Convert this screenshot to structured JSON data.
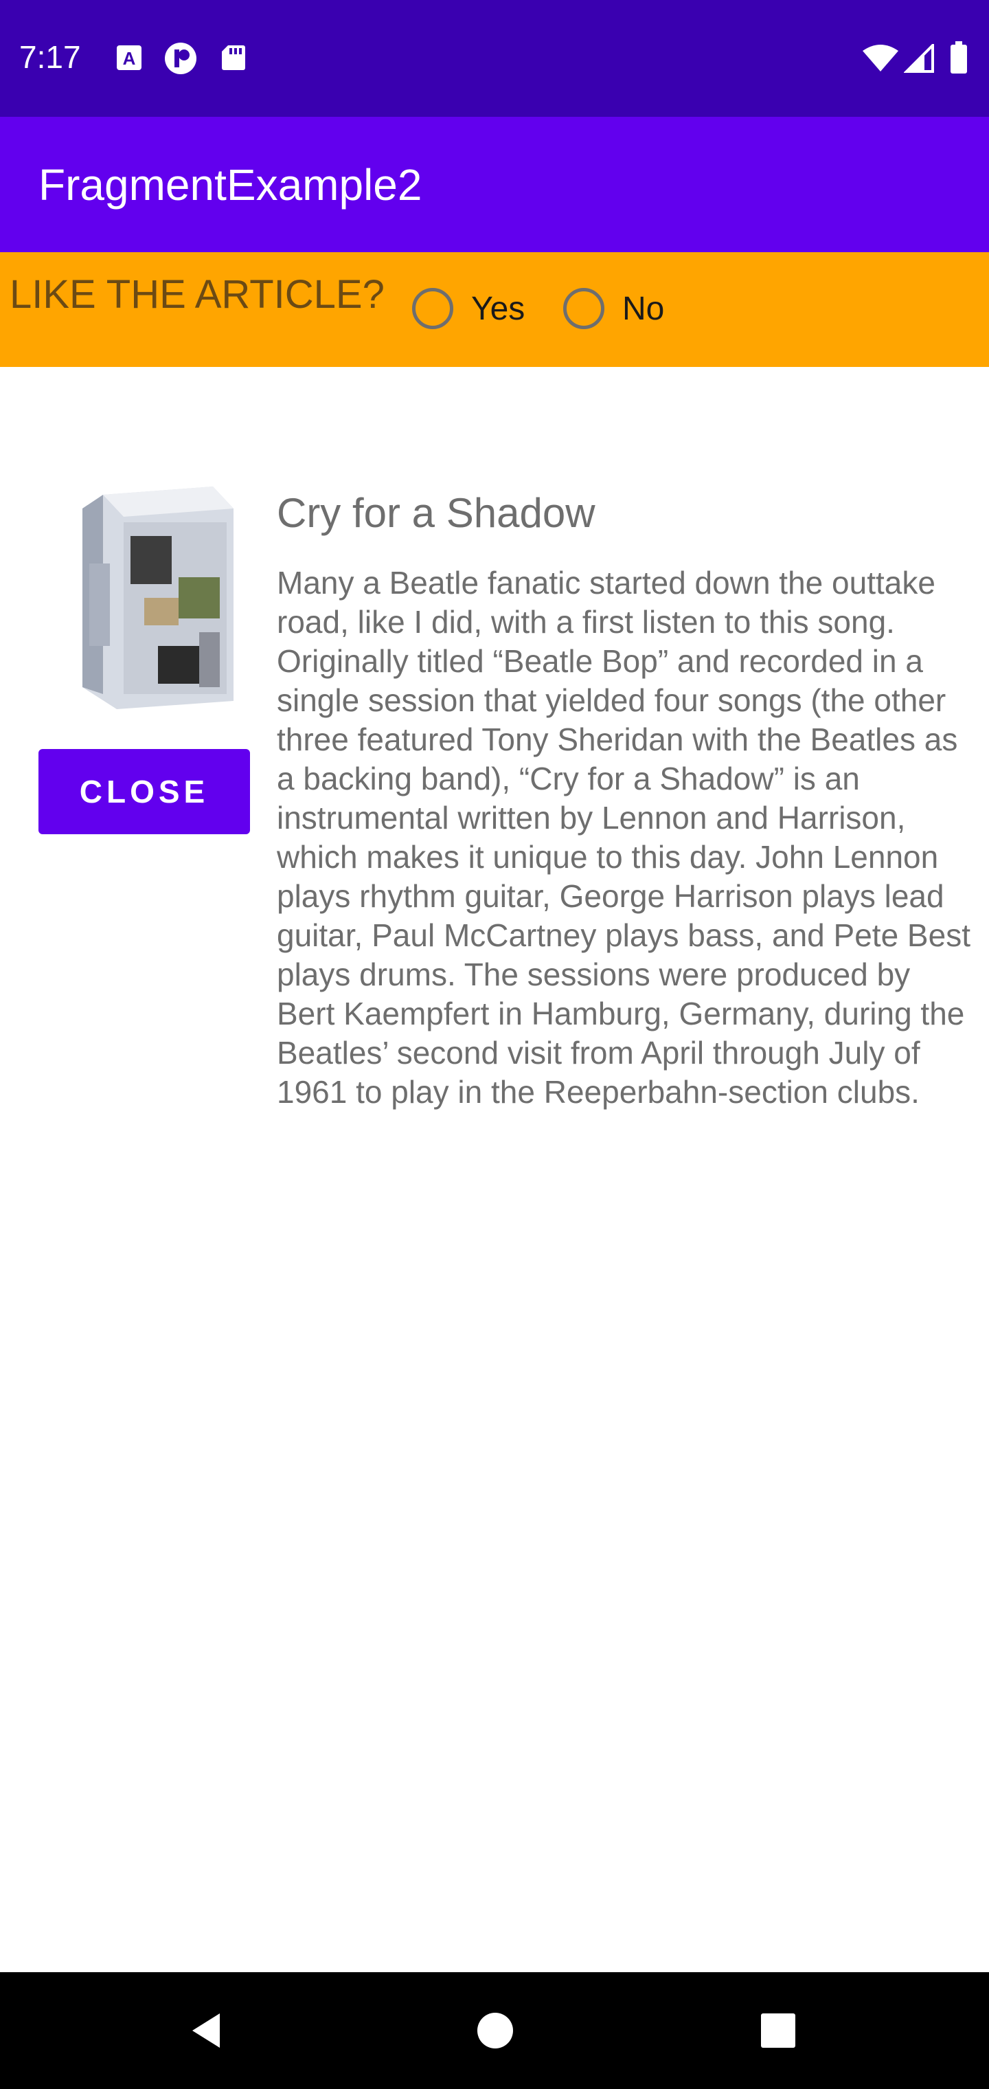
{
  "status_bar": {
    "time": "7:17",
    "left_icons": [
      "a-icon",
      "p-icon",
      "sd-card-icon"
    ],
    "right_icons": [
      "wifi-icon",
      "signal-icon",
      "battery-icon"
    ]
  },
  "app_bar": {
    "title": "FragmentExample2"
  },
  "question": {
    "label": "LIKE THE ARTICLE?",
    "options": [
      {
        "label": "Yes",
        "checked": false
      },
      {
        "label": "No",
        "checked": false
      }
    ]
  },
  "article": {
    "title": "Cry for a Shadow",
    "body": "Many a Beatle fanatic started down the outtake road, like I did, with a first listen to this song. Originally titled “Beatle Bop” and recorded in a single session that yielded four songs (the other three featured Tony Sheridan with the Beatles as a backing band), “Cry for a Shadow” is an instrumental written by Lennon and Harrison, which makes it unique to this day. John Lennon plays rhythm guitar, George Harrison plays lead guitar, Paul McCartney plays bass, and Pete Best plays drums. The sessions were produced by Bert Kaempfert in Hamburg, Germany, during the Beatles’ second visit from April through July of 1961 to play in the Reeperbahn-section clubs."
  },
  "close_button": {
    "label": "CLOSE"
  },
  "nav_bar": {
    "icons": [
      "back-icon",
      "home-icon",
      "recents-icon"
    ]
  },
  "colors": {
    "status_bar": "#3a00b0",
    "app_bar": "#6200ee",
    "question_bar": "#ffa500",
    "button": "#6200ee"
  }
}
